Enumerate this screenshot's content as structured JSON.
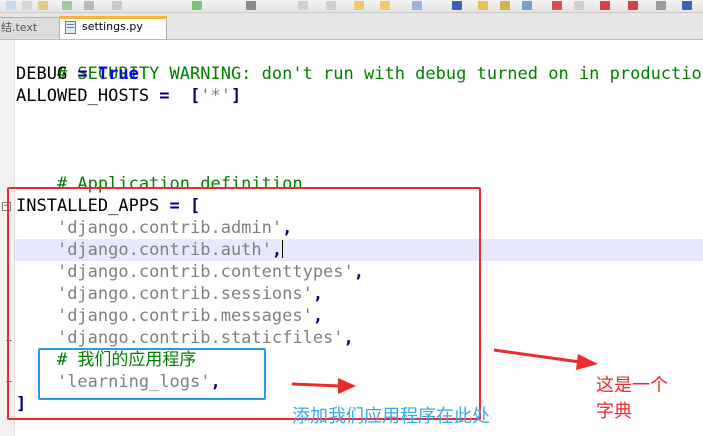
{
  "tabs": [
    {
      "label": "结.text",
      "active": false
    },
    {
      "label": "settings.py",
      "active": true
    }
  ],
  "editor": {
    "lines": {
      "l1": "# SECURITY WARNING: don't run with debug turned on in production!",
      "l2_name": "DEBUG",
      "l2_eq": " = ",
      "l2_val": "True",
      "l3_name": "ALLOWED_HOSTS",
      "l3_eq": " = ",
      "l3_b1": "[",
      "l3_str": "'*'",
      "l3_b2": "]",
      "l6": "# Application definition",
      "l8_name": "INSTALLED_APPS",
      "l8_eq": " = ",
      "l8_b": "[",
      "apps": [
        "'django.contrib.admin'",
        "'django.contrib.auth'",
        "'django.contrib.contenttypes'",
        "'django.contrib.sessions'",
        "'django.contrib.messages'",
        "'django.contrib.staticfiles'"
      ],
      "comma": ",",
      "my_comment": "# 我们的应用程序",
      "my_app": "'learning_logs'",
      "close": "]"
    }
  },
  "annotations": {
    "blue_note": "添加我们应用程序在此处",
    "red_note": "这是一个\n字典"
  },
  "colors": {
    "comment": "#008000",
    "string": "#808080",
    "keyword": "#0000ff",
    "annotation_red": "#ee2b2b",
    "annotation_blue": "#2b9be6"
  }
}
